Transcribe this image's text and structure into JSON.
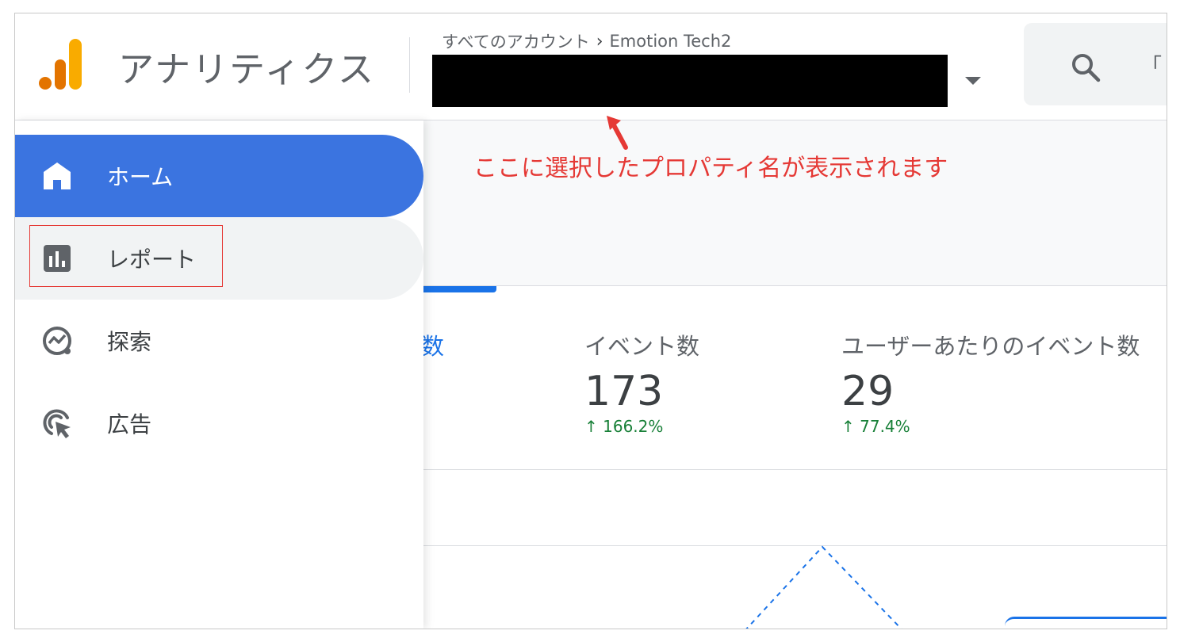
{
  "header": {
    "app_title": "アナリティクス",
    "breadcrumb": {
      "root": "すべてのアカウント",
      "separator": "›",
      "account": "Emotion Tech2"
    },
    "search": {
      "placeholder_fragment": "「"
    }
  },
  "sidebar": {
    "items": [
      {
        "label": "ホーム",
        "icon": "home-icon",
        "active": true
      },
      {
        "label": "レポート",
        "icon": "bar-chart-icon",
        "active": false
      },
      {
        "label": "探索",
        "icon": "explore-icon",
        "active": false
      },
      {
        "label": "広告",
        "icon": "ads-cursor-icon",
        "active": false
      }
    ]
  },
  "annotation": {
    "text": "ここに選択したプロパティ名が表示されます",
    "color": "#e53935"
  },
  "metrics": [
    {
      "label": "数"
    },
    {
      "label": "イベント数",
      "value": "173",
      "change": "166.2%"
    },
    {
      "label": "ユーザーあたりのイベント数",
      "value": "29",
      "change": "77.4%"
    }
  ],
  "colors": {
    "accent": "#1a73e8",
    "nav_active": "#3b74e0",
    "positive": "#188038",
    "annotation": "#e53935",
    "logo_orange": "#e37400",
    "logo_yellow": "#f9ab00"
  }
}
